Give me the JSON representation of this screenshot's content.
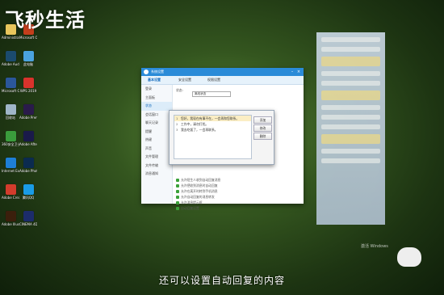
{
  "watermark": "飞秒生活",
  "subtitle": "还可以设置自动回复的内容",
  "activate_windows": "激活 Windows",
  "desktop_icons": [
    {
      "label": "Administrator",
      "color": "#e8c65c"
    },
    {
      "label": "Microsoft Office",
      "color": "#c43e1c"
    },
    {
      "label": "Adobe Audition",
      "color": "#1b4b6e"
    },
    {
      "label": "此电脑",
      "color": "#4aa3df"
    },
    {
      "label": "Microsoft Office Wo...",
      "color": "#2b579a"
    },
    {
      "label": "WPS 2019",
      "color": "#d9332c"
    },
    {
      "label": "回收站",
      "color": "#9fb6c8"
    },
    {
      "label": "Adobe Premiere",
      "color": "#2a1b4a"
    },
    {
      "label": "360安全卫士",
      "color": "#3a9c3c"
    },
    {
      "label": "Adobe After Effects",
      "color": "#1a1a4a"
    },
    {
      "label": "Internet Explorer",
      "color": "#1e7fd6"
    },
    {
      "label": "Adobe Photoshop",
      "color": "#0b2b4f"
    },
    {
      "label": "Adobe Creative",
      "color": "#d23c2c"
    },
    {
      "label": "腾讯QQ",
      "color": "#1a9be6"
    },
    {
      "label": "Adobe Illustrator",
      "color": "#3b1f0c"
    },
    {
      "label": "CINEMA 4D",
      "color": "#1c2c6b"
    }
  ],
  "settings_window": {
    "title": "系统设置",
    "tabs": [
      "基本设置",
      "安全设置",
      "权限设置"
    ],
    "menu": [
      "登录",
      "主面板",
      "状态",
      "会话窗口",
      "聊天记录",
      "提醒",
      "热键",
      "声音",
      "文件管理",
      "文件传输",
      "消息通知"
    ],
    "status_label": "状态:",
    "status_value": "离线状态",
    "rows": [
      "允许我离开时自动回复",
      "允许自动回复",
      "允许我的联系人在我离开时收到",
      "允许陌生人收到自动回复消息",
      "允许把收到消息时自动回复",
      "允许在离开时转到手机消息",
      "允许自动回复的消息转发",
      "允许消息提示框",
      "自动回复设置"
    ]
  },
  "auto_reply_dialog": {
    "items": [
      {
        "num": "1",
        "text": "您好，我现在有事不在，一会再和您联系。"
      },
      {
        "num": "2",
        "text": "工作中，请勿打扰。"
      },
      {
        "num": "3",
        "text": "我去吃饭了，一会再联系。"
      }
    ],
    "buttons": [
      "添加",
      "修改",
      "删除"
    ]
  }
}
